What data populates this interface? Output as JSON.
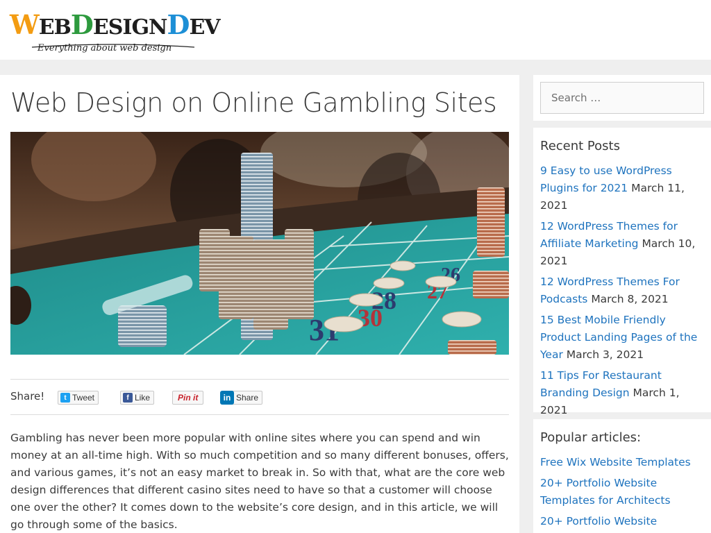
{
  "header": {
    "logo_part1": "W",
    "logo_part2": "EB",
    "logo_part3": "D",
    "logo_part4": "ESIGN",
    "logo_part5": "D",
    "logo_part6": "EV",
    "tagline": "Everything about web design"
  },
  "post": {
    "title": "Web Design on Online Gambling Sites",
    "share_label": "Share!",
    "share_buttons": {
      "tweet": "Tweet",
      "like": "Like",
      "pinit": "Pin it",
      "share": "Share"
    },
    "intro": "Gambling has never been more popular with online sites where you can spend and win money at an all-time high. With so much competition and so many different bonuses, offers, and various games, it’s not an easy market to break in. So with that, what are the core web design differences that different casino sites need to have so that a customer will choose one over the other? It comes down to the website’s core design, and in this article, we will go through some of the basics."
  },
  "sidebar": {
    "search_placeholder": "Search …",
    "recent_title": "Recent Posts",
    "recent_posts": [
      {
        "title": "9 Easy to use WordPress Plugins for 2021",
        "date": "March 11, 2021"
      },
      {
        "title": "12 WordPress Themes for Affiliate Marketing",
        "date": "March 10, 2021"
      },
      {
        "title": "12 WordPress Themes For Podcasts",
        "date": "March 8, 2021"
      },
      {
        "title": "15 Best Mobile Friendly Product Landing Pages of the Year",
        "date": "March 3, 2021"
      },
      {
        "title": "11 Tips For Restaurant Branding Design",
        "date": "March 1, 2021"
      }
    ],
    "popular_title": "Popular articles:",
    "popular_posts": [
      {
        "title": "Free Wix Website Templates"
      },
      {
        "title": "20+ Portfolio Website Templates for Architects"
      },
      {
        "title": "20+ Portfolio Website"
      }
    ]
  },
  "colors": {
    "link": "#1e73be",
    "text": "#3a3a3a",
    "background": "#efefef",
    "table_felt": "#2a9d9a"
  }
}
